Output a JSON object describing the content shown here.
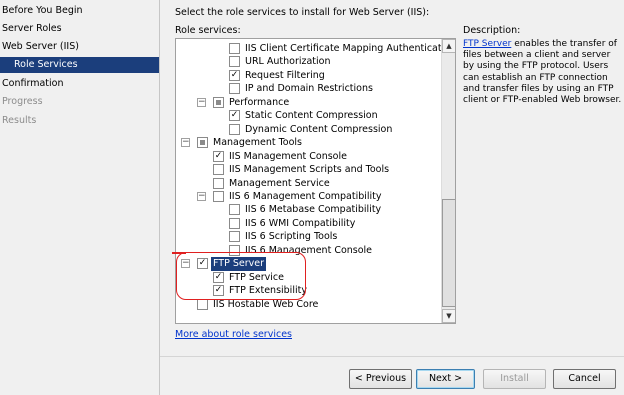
{
  "nav": {
    "items": [
      {
        "label": "Before You Begin",
        "state": "normal",
        "sub": false
      },
      {
        "label": "Server Roles",
        "state": "normal",
        "sub": false
      },
      {
        "label": "Web Server (IIS)",
        "state": "normal",
        "sub": false
      },
      {
        "label": "Role Services",
        "state": "active",
        "sub": true
      },
      {
        "label": "Confirmation",
        "state": "normal",
        "sub": false
      },
      {
        "label": "Progress",
        "state": "disabled",
        "sub": false
      },
      {
        "label": "Results",
        "state": "disabled",
        "sub": false
      }
    ]
  },
  "main": {
    "instruction": "Select the role services to install for Web Server (IIS):",
    "role_services_label": "Role services:",
    "more_link": "More about role services"
  },
  "tree": {
    "rows": [
      {
        "label": "IIS Client Certificate Mapping Authentication",
        "checked": false,
        "level": 3
      },
      {
        "label": "URL Authorization",
        "checked": false,
        "level": 3
      },
      {
        "label": "Request Filtering",
        "checked": true,
        "level": 3
      },
      {
        "label": "IP and Domain Restrictions",
        "checked": false,
        "level": 3
      },
      {
        "label": "Performance",
        "checked": "partial",
        "level": 2,
        "expander": "−"
      },
      {
        "label": "Static Content Compression",
        "checked": true,
        "level": 3
      },
      {
        "label": "Dynamic Content Compression",
        "checked": false,
        "level": 3
      },
      {
        "label": "Management Tools",
        "checked": "partial",
        "level": 1,
        "expander": "−"
      },
      {
        "label": "IIS Management Console",
        "checked": true,
        "level": 2
      },
      {
        "label": "IIS Management Scripts and Tools",
        "checked": false,
        "level": 2
      },
      {
        "label": "Management Service",
        "checked": false,
        "level": 2
      },
      {
        "label": "IIS 6 Management Compatibility",
        "checked": false,
        "level": 2,
        "expander": "−"
      },
      {
        "label": "IIS 6 Metabase Compatibility",
        "checked": false,
        "level": 3
      },
      {
        "label": "IIS 6 WMI Compatibility",
        "checked": false,
        "level": 3
      },
      {
        "label": "IIS 6 Scripting Tools",
        "checked": false,
        "level": 3
      },
      {
        "label": "IIS 6 Management Console",
        "checked": false,
        "level": 3
      },
      {
        "label": "FTP Server",
        "checked": true,
        "level": 1,
        "expander": "−",
        "selected": true
      },
      {
        "label": "FTP Service",
        "checked": true,
        "level": 2
      },
      {
        "label": "FTP Extensibility",
        "checked": true,
        "level": 2
      },
      {
        "label": "IIS Hostable Web Core",
        "checked": false,
        "level": 1
      }
    ]
  },
  "description": {
    "label": "Description:",
    "link": "FTP Server",
    "text": " enables the transfer of files between a client and server by using the FTP protocol. Users can establish an FTP connection and transfer files by using an FTP client or FTP-enabled Web browser."
  },
  "buttons": {
    "previous": "< Previous",
    "next": "Next >",
    "install": "Install",
    "cancel": "Cancel"
  },
  "icons": {
    "scroll_up": "scroll-up-arrow-icon",
    "scroll_down": "scroll-down-arrow-icon",
    "checkmark": "check-icon",
    "collapse": "collapse-minus-icon"
  },
  "colors": {
    "selection": "#1b3e7c",
    "link": "#0033cc",
    "annotation": "#e02020"
  }
}
